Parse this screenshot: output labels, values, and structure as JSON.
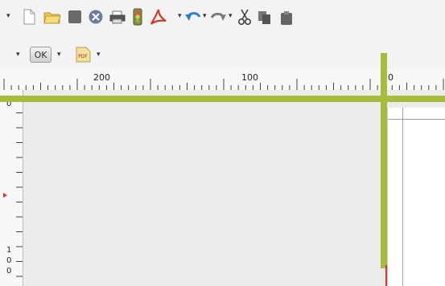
{
  "toolbar_main": {
    "icons": [
      "dropdown-arrow-icon",
      "new-document-icon",
      "open-folder-icon",
      "save-icon",
      "close-document-icon",
      "print-icon",
      "preflight-icon",
      "export-pdf-icon",
      "dropdown-arrow-icon",
      "undo-icon",
      "redo-icon",
      "cut-icon",
      "copy-icon",
      "paste-icon"
    ]
  },
  "toolbar_secondary": {
    "ok_label": "OK",
    "pdf_badge": "PDF"
  },
  "rulers": {
    "horizontal_labels": [
      "200",
      "100",
      "0"
    ],
    "vertical_label_top": "0",
    "vertical_label_bottom": [
      "1",
      "0",
      "0"
    ]
  },
  "colors": {
    "guide": "#a6bd3c",
    "toolbar_bg": "#f3f3f3",
    "canvas_bg": "#ececec",
    "page_bg": "#ffffff"
  }
}
